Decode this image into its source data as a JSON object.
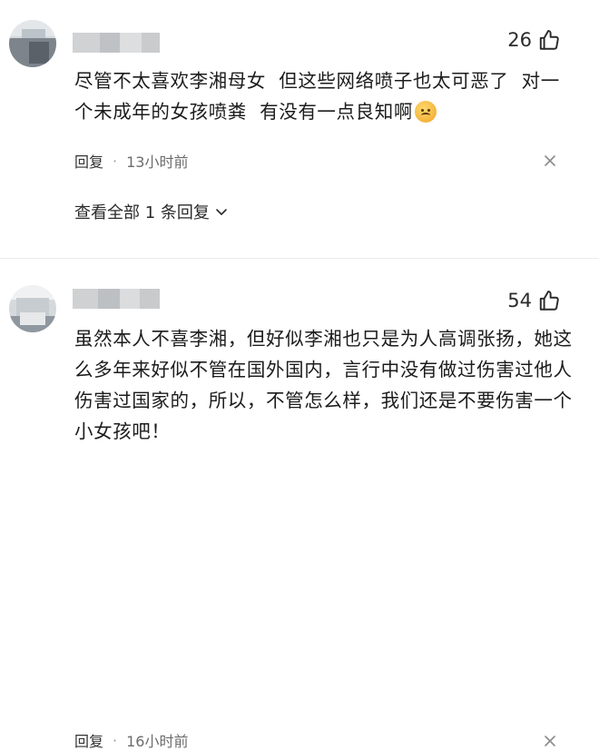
{
  "comments": [
    {
      "likes": "26",
      "text": "尽管不太喜欢李湘母女  但这些网络喷子也太可恶了  对一个未成年的女孩喷粪  有没有一点良知啊",
      "has_emoji": true,
      "reply_label": "回复",
      "time": "13小时前",
      "view_all": "查看全部 1 条回复"
    },
    {
      "likes": "54",
      "text": "虽然本人不喜李湘，但好似李湘也只是为人高调张扬，她这么多年来好似不管在国外国内，言行中没有做过伤害过他人伤害过国家的，所以，不管怎么样，我们还是不要伤害一个小女孩吧！",
      "reply_label": "回复",
      "time": "16小时前"
    }
  ],
  "icons": {
    "like": "thumbs-up-icon",
    "close": "close-icon",
    "chevron": "chevron-down-icon",
    "emoji": "angry-face-emoji"
  },
  "separator": "·"
}
